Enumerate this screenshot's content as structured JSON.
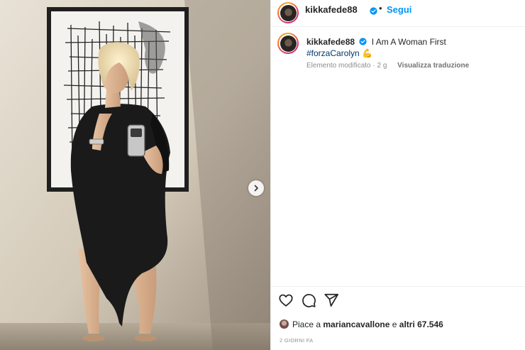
{
  "post": {
    "username": "kikkafede88",
    "follow_label": "Segui",
    "separator": "•",
    "caption_text": "I Am A Woman First",
    "hashtag": "#forzaCarolyn",
    "hashtag_emoji": "💪",
    "edited_label": "Elemento modificato · 2 g",
    "translate_label": "Visualizza traduzione",
    "likes_prefix": "Piace a ",
    "likes_user": "mariancavallone",
    "likes_conjunction": " e ",
    "likes_others": "altri 67.546",
    "date_label": "2 GIORNI FA"
  },
  "colors": {
    "link_blue": "#0095f6",
    "hashtag_blue": "#00376b",
    "verified_blue": "#0095f6",
    "muted_text": "#8e8e8e"
  },
  "icons": {
    "like": "heart-icon",
    "comment": "comment-icon",
    "share": "share-icon",
    "verified": "verified-badge-icon",
    "next": "chevron-right-icon"
  }
}
